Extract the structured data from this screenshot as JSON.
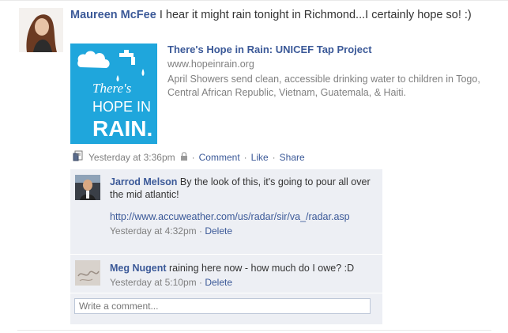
{
  "post": {
    "author": "Maureen McFee",
    "text": " I hear it might rain tonight in Richmond...I certainly hope so! :)",
    "attachment": {
      "title": "There's Hope in Rain: UNICEF Tap Project",
      "url": "www.hopeinrain.org",
      "description": "April Showers send clean, accessible drinking water to children in Togo, Central African Republic, Vietnam, Guatemala, & Haiti.",
      "image_text_line1": "There's",
      "image_text_line2": "HOPE IN",
      "image_text_line3": "RAIN.",
      "image_bg": "#1fa6dc"
    },
    "timestamp": "Yesterday at 3:36pm",
    "dot": "·",
    "actions": {
      "comment": "Comment",
      "like": "Like",
      "share": "Share"
    }
  },
  "comments": [
    {
      "author": "Jarrod Melson",
      "text": " By the look of this, it's going to pour all over the mid atlantic!",
      "link": "http://www.accuweather.com/us/radar/sir/va_/radar.asp",
      "time": "Yesterday at 4:32pm",
      "delete": "Delete"
    },
    {
      "author": "Meg Nugent",
      "text": " raining here now - how much do I owe? :D",
      "time": "Yesterday at 5:10pm",
      "delete": "Delete"
    }
  ],
  "composer": {
    "placeholder": "Write a comment..."
  },
  "colors": {
    "link": "#3b5998",
    "muted": "#808080",
    "comment_bg": "#edeff4"
  }
}
